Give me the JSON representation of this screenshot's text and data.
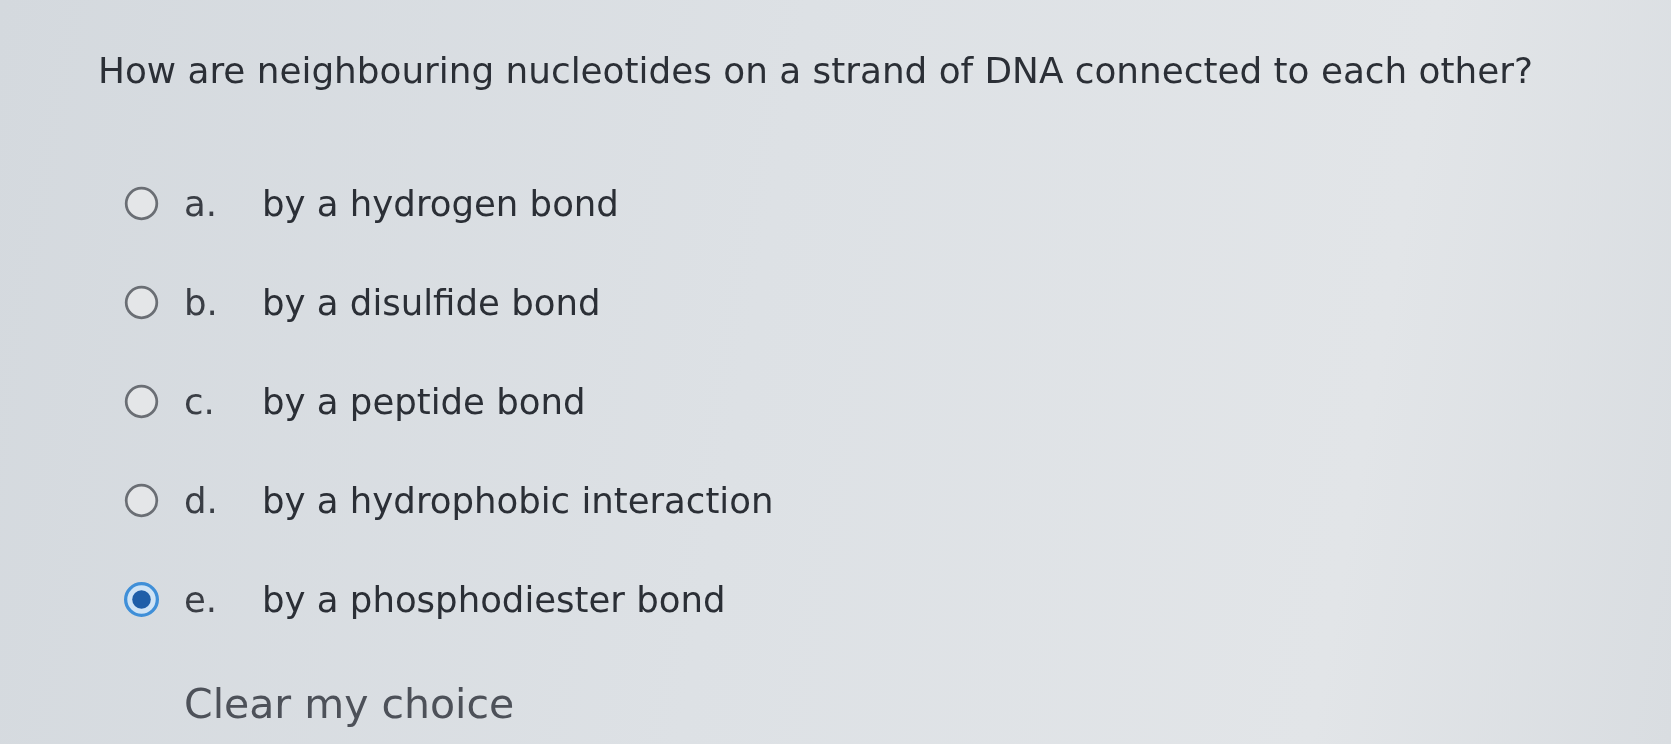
{
  "question": "How are neighbouring nucleotides on a strand of DNA connected to each other?",
  "options": [
    {
      "letter": "a.",
      "text": "by a hydrogen bond",
      "selected": false
    },
    {
      "letter": "b.",
      "text": "by a disulfide bond",
      "selected": false
    },
    {
      "letter": "c.",
      "text": "by a peptide bond",
      "selected": false
    },
    {
      "letter": "d.",
      "text": "by a hydrophobic interaction",
      "selected": false
    },
    {
      "letter": "e.",
      "text": "by a phosphodiester bond",
      "selected": true
    }
  ],
  "clear_link": "Clear my choice"
}
